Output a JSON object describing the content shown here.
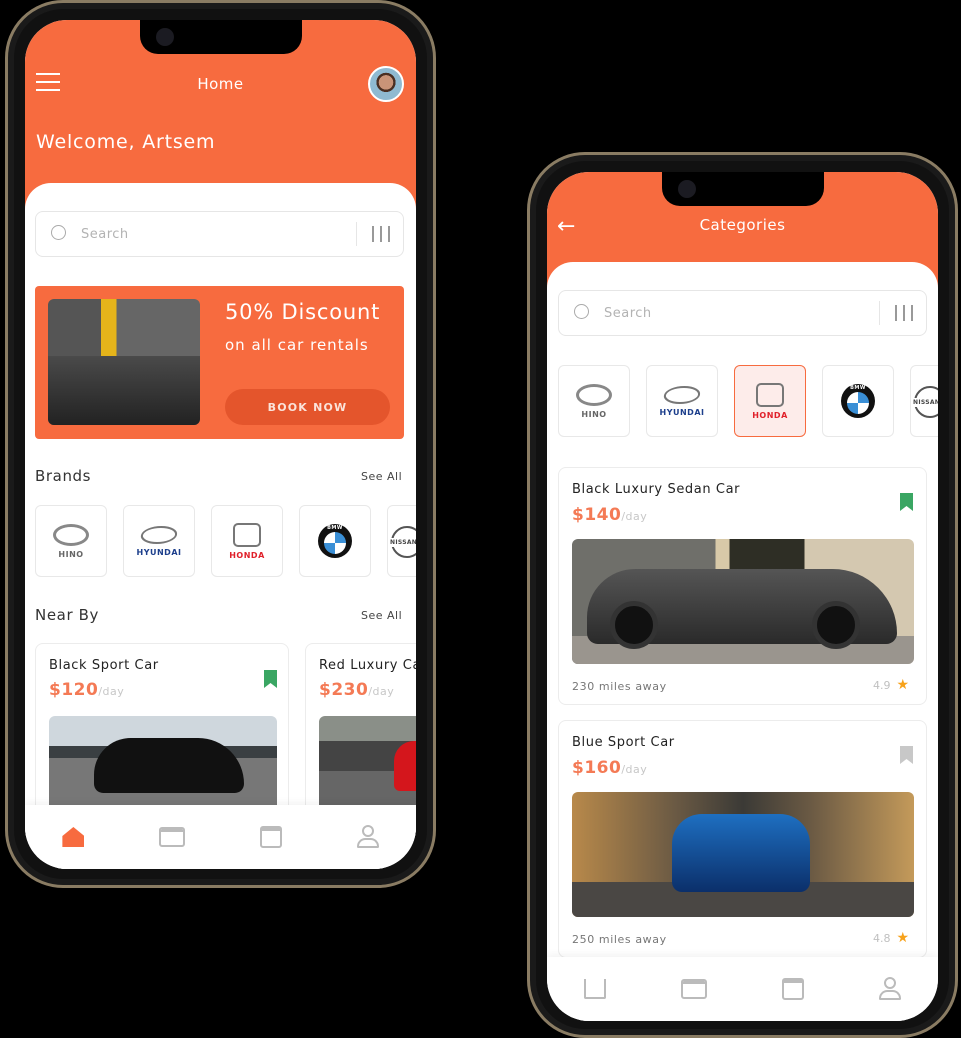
{
  "home": {
    "title": "Home",
    "welcome": "Welcome, Artsem",
    "search_placeholder": "Search",
    "promo": {
      "headline": "50% Discount",
      "subline": "on all car rentals",
      "button": "BOOK NOW"
    },
    "brands_title": "Brands",
    "brands_see_all": "See All",
    "brands": [
      {
        "label": "HINO",
        "color": "#666"
      },
      {
        "label": "HYUNDAI",
        "color": "#1d3f8c"
      },
      {
        "label": "HONDA",
        "color": "#e0202a"
      },
      {
        "label": "BMW",
        "color": "#000"
      },
      {
        "label": "NISSAN",
        "color": "#555"
      }
    ],
    "nearby_title": "Near By",
    "nearby_see_all": "See All",
    "nearby": [
      {
        "name": "Black Sport Car",
        "price": "$120",
        "unit": "/day",
        "saved": true
      },
      {
        "name": "Red Luxury Car",
        "price": "$230",
        "unit": "/day",
        "saved": false
      }
    ],
    "tabs": [
      "home-icon",
      "card-icon",
      "calendar-icon",
      "user-icon"
    ],
    "active_tab": "home"
  },
  "categories": {
    "title": "Categories",
    "search_placeholder": "Search",
    "selected_brand": "HONDA",
    "cars": [
      {
        "name": "Black Luxury Sedan Car",
        "price": "$140",
        "unit": "/day",
        "distance": "230 miles away",
        "rating": "4.9",
        "saved": true
      },
      {
        "name": "Blue Sport Car",
        "price": "$160",
        "unit": "/day",
        "distance": "250 miles away",
        "rating": "4.8",
        "saved": false
      }
    ]
  },
  "colors": {
    "accent": "#f76b3f",
    "saved": "#3aa663",
    "unsaved": "#c8c8c8",
    "star": "#f7a21b"
  }
}
